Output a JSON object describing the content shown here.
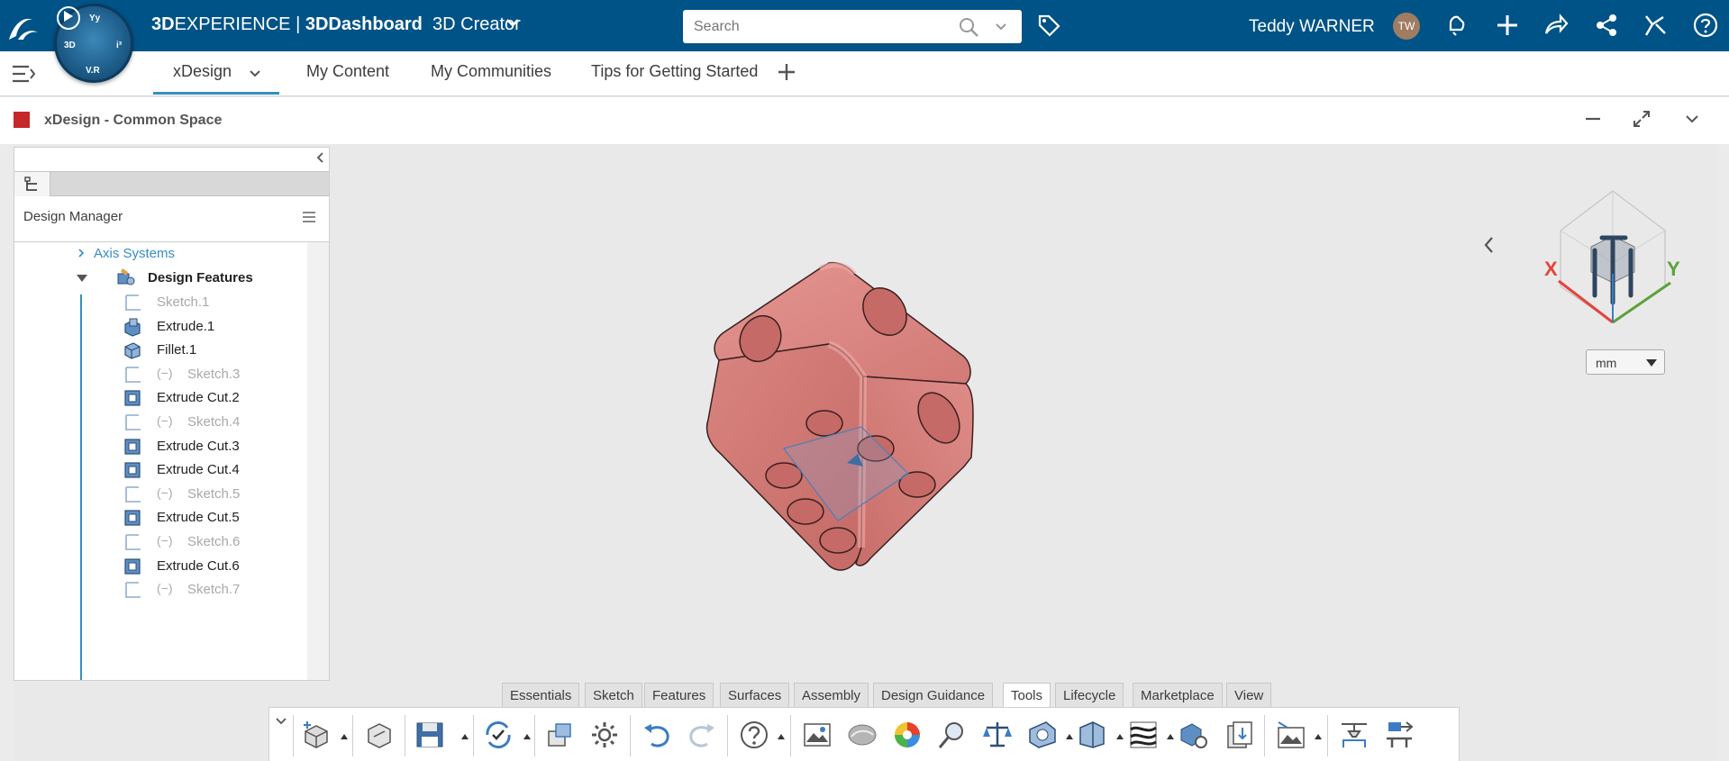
{
  "topbar": {
    "brand_bold": "3D",
    "brand_rest": "EXPERIENCE",
    "separator": " | ",
    "app_bold": "3D",
    "app_rest": "Dashboard",
    "role": "3D Creator",
    "search_placeholder": "Search",
    "user_name": "Teddy WARNER",
    "user_initials": "TW",
    "accent": "#005386"
  },
  "compass": {
    "top": "Yy",
    "left": "3D",
    "right": "i³",
    "bottom": "V.R"
  },
  "tabs": [
    {
      "label": "xDesign"
    },
    {
      "label": "My Content"
    },
    {
      "label": "My Communities"
    },
    {
      "label": "Tips for Getting Started"
    }
  ],
  "widget": {
    "title": "xDesign - Common Space"
  },
  "panel": {
    "title": "Design Manager",
    "tree": [
      {
        "label": "Axis Systems"
      },
      {
        "label": "Design Features"
      },
      {
        "label": "Sketch.1"
      },
      {
        "label": "Extrude.1"
      },
      {
        "label": "Fillet.1"
      },
      {
        "label": "Sketch.3"
      },
      {
        "label": "Extrude Cut.2"
      },
      {
        "label": "Sketch.4"
      },
      {
        "label": "Extrude Cut.3"
      },
      {
        "label": "Extrude Cut.4"
      },
      {
        "label": "Sketch.5"
      },
      {
        "label": "Extrude Cut.5"
      },
      {
        "label": "Sketch.6"
      },
      {
        "label": "Extrude Cut.6"
      },
      {
        "label": "Sketch.7"
      }
    ]
  },
  "navcube": {
    "x_label": "X",
    "y_label": "Y",
    "unit": "mm"
  },
  "action_tabs": [
    "Essentials",
    "Sketch",
    "Features",
    "Surfaces",
    "Assembly",
    "Design Guidance",
    "Tools",
    "Lifecycle",
    "Marketplace",
    "View"
  ],
  "active_action_tab": "Tools",
  "colors": {
    "die": "#d9817d",
    "selection": "#368ec4"
  }
}
